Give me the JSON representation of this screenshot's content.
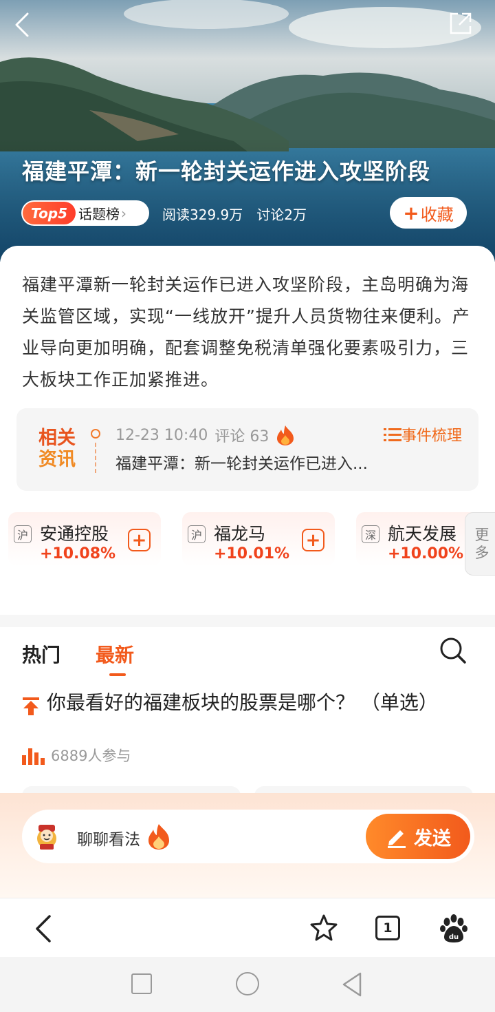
{
  "hero": {
    "title": "福建平潭：新一轮封关运作进入攻坚阶段",
    "rank_badge": "Top5",
    "rank_label": "话题榜",
    "reads": "阅读329.9万",
    "discussions": "讨论2万",
    "collect_label": "收藏"
  },
  "summary": "福建平潭新一轮封关运作已进入攻坚阶段，主岛明确为海关监管区域，实现“一线放开”提升人员货物往来便利。产业导向更加明确，配套调整免税清单强化要素吸引力，三大板块工作正加紧推进。",
  "related_news": {
    "logo_line1": "相关",
    "logo_line2": "资讯",
    "time": "12-23 10:40",
    "comments": "评论 63",
    "headline": "福建平潭：新一轮封关运作已进入...",
    "event_link": "事件梳理"
  },
  "stocks": [
    {
      "market": "沪",
      "name": "安通控股",
      "change": "+10.08%"
    },
    {
      "market": "沪",
      "name": "福龙马",
      "change": "+10.01%"
    },
    {
      "market": "深",
      "name": "航天发展",
      "change": "+10.00%"
    }
  ],
  "more_label_1": "更",
  "more_label_2": "多",
  "tabs": {
    "hot": "热门",
    "latest": "最新",
    "active": "latest"
  },
  "poll": {
    "question": "你最看好的福建板块的股票是哪个？ （单选）",
    "participants": "6889人参与"
  },
  "comment": {
    "placeholder": "聊聊看法",
    "send_label": "发送"
  },
  "toolbar": {
    "tab_count": "1"
  },
  "colors": {
    "accent": "#f25a1c",
    "rise": "#f0431c"
  }
}
